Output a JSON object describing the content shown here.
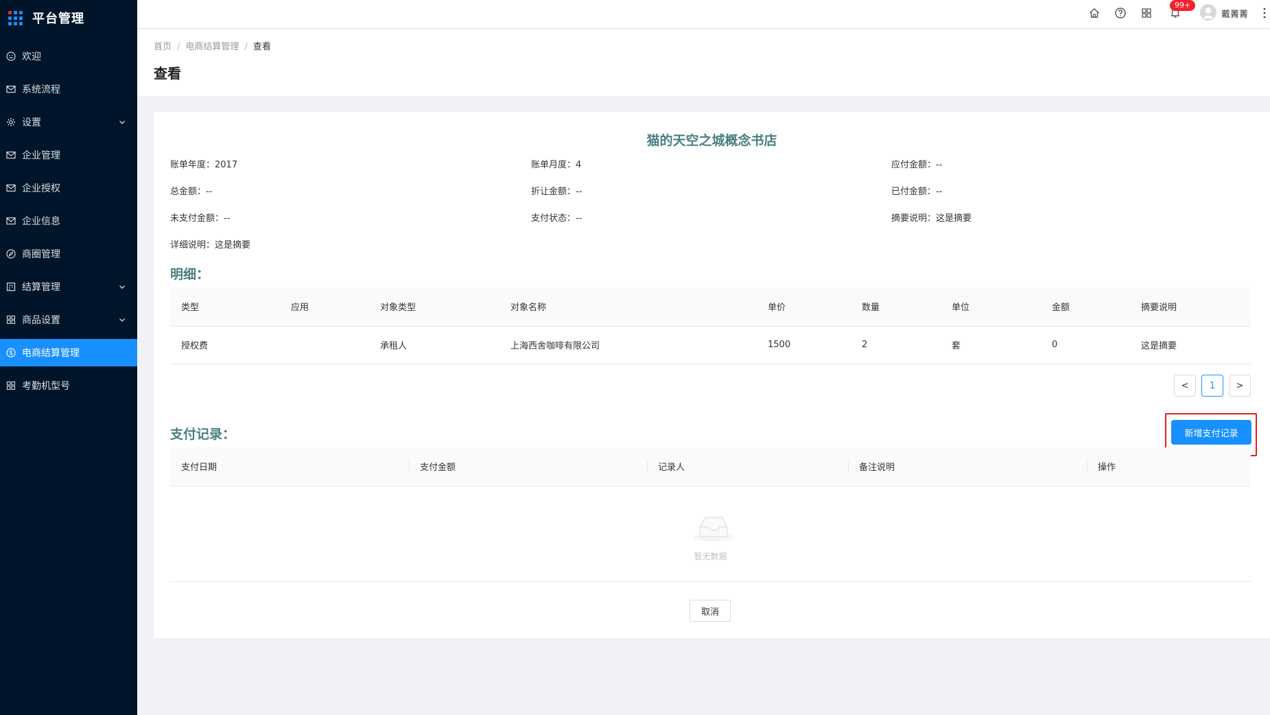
{
  "app": {
    "title": "平台管理"
  },
  "colors": {
    "sidebar_bg": "#001529",
    "accent": "#1890ff",
    "title_teal": "#4a7f82",
    "badge_red": "#f5222d"
  },
  "sidebar": {
    "items": [
      {
        "label": "欢迎",
        "icon": "smile-icon"
      },
      {
        "label": "系统流程",
        "icon": "mail-icon"
      },
      {
        "label": "设置",
        "icon": "gear-icon",
        "expandable": true
      },
      {
        "label": "企业管理",
        "icon": "mail-icon"
      },
      {
        "label": "企业授权",
        "icon": "mail-icon"
      },
      {
        "label": "企业信息",
        "icon": "mail-icon"
      },
      {
        "label": "商圈管理",
        "icon": "compass-icon"
      },
      {
        "label": "结算管理",
        "icon": "calculator-icon",
        "expandable": true
      },
      {
        "label": "商品设置",
        "icon": "appstore-icon",
        "expandable": true
      },
      {
        "label": "电商结算管理",
        "icon": "dollar-icon",
        "active": true
      },
      {
        "label": "考勤机型号",
        "icon": "appstore-icon"
      }
    ]
  },
  "header": {
    "badge": "99+",
    "username": "戴菁菁",
    "icons": [
      "home-icon",
      "question-icon",
      "appstore-icon",
      "bell-icon",
      "more-vertical-icon"
    ]
  },
  "breadcrumb": {
    "home": "首页",
    "parent": "电商结算管理",
    "current": "查看"
  },
  "page_title": "查看",
  "detail": {
    "shop_name": "猫的天空之城概念书店",
    "fields": {
      "bill_year": "账单年度：2017",
      "bill_month": "账单月度：4",
      "payable": "应付金额：--",
      "total": "总金额：--",
      "discount": "折让金额：--",
      "paid": "已付金额：--",
      "unpaid": "未支付金额：--",
      "pay_status": "支付状态：--",
      "summary": "摘要说明：这是摘要",
      "detail_desc": "详细说明：这是摘要"
    }
  },
  "detail_table": {
    "section_title": "明细：",
    "columns": [
      "类型",
      "应用",
      "对象类型",
      "对象名称",
      "单价",
      "数量",
      "单位",
      "金额",
      "摘要说明"
    ],
    "rows": [
      [
        "授权费",
        "",
        "承租人",
        "上海西舍咖啡有限公司",
        "1500",
        "2",
        "套",
        "0",
        "这是摘要"
      ]
    ],
    "pagination": {
      "prev": "<",
      "current_page": "1",
      "next": ">"
    }
  },
  "payment": {
    "section_title": "支付记录：",
    "add_button": "新增支付记录",
    "columns": [
      "支付日期",
      "支付金额",
      "记录人",
      "备注说明",
      "操作"
    ],
    "empty_text": "暂无数据"
  },
  "footer": {
    "cancel": "取消"
  }
}
